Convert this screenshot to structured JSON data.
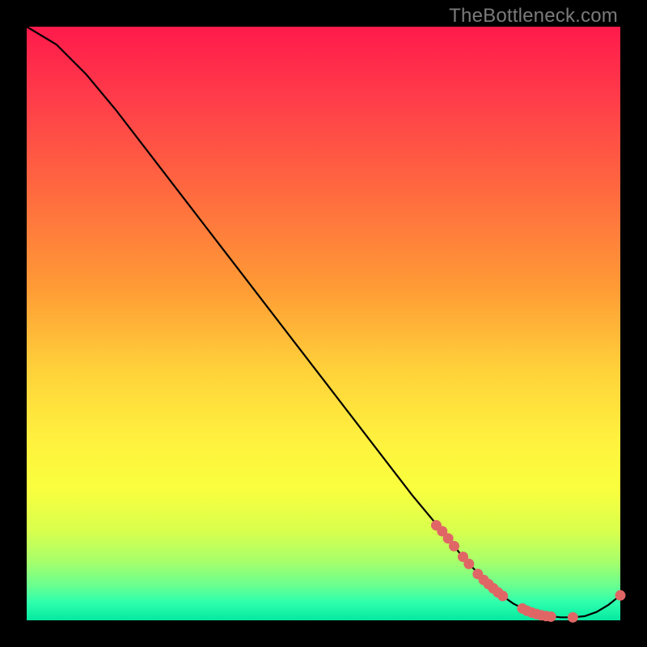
{
  "attribution": "TheBottleneck.com",
  "colors": {
    "background": "#000000",
    "curve": "#000000",
    "marker": "#e06666",
    "gradient_top": "#ff1a4b",
    "gradient_bottom": "#05e8a0"
  },
  "chart_data": {
    "type": "line",
    "title": "",
    "xlabel": "",
    "ylabel": "",
    "xlim": [
      0,
      100
    ],
    "ylim": [
      0,
      100
    ],
    "series": [
      {
        "name": "curve",
        "x": [
          0,
          5,
          10,
          15,
          20,
          25,
          30,
          35,
          40,
          45,
          50,
          55,
          60,
          65,
          70,
          74,
          78,
          80,
          82,
          84,
          86,
          88,
          90,
          92,
          94,
          96,
          98,
          100
        ],
        "y": [
          100,
          97,
          92,
          86,
          79.5,
          73,
          66.5,
          60,
          53.5,
          47,
          40.5,
          34,
          27.5,
          21,
          15,
          10,
          6,
          4.2,
          2.8,
          1.8,
          1.1,
          0.7,
          0.5,
          0.5,
          0.7,
          1.4,
          2.6,
          4.2
        ]
      }
    ],
    "markers": [
      {
        "x": 69,
        "y": 16.0
      },
      {
        "x": 70,
        "y": 15.0
      },
      {
        "x": 71,
        "y": 13.8
      },
      {
        "x": 72,
        "y": 12.5
      },
      {
        "x": 73.5,
        "y": 10.7
      },
      {
        "x": 74.5,
        "y": 9.5
      },
      {
        "x": 76,
        "y": 7.8
      },
      {
        "x": 77,
        "y": 6.8
      },
      {
        "x": 77.8,
        "y": 6.1
      },
      {
        "x": 78.6,
        "y": 5.4
      },
      {
        "x": 79.4,
        "y": 4.7
      },
      {
        "x": 80.2,
        "y": 4.1
      },
      {
        "x": 83.5,
        "y": 2.0
      },
      {
        "x": 84.3,
        "y": 1.6
      },
      {
        "x": 85.1,
        "y": 1.3
      },
      {
        "x": 85.9,
        "y": 1.05
      },
      {
        "x": 86.7,
        "y": 0.85
      },
      {
        "x": 87.5,
        "y": 0.72
      },
      {
        "x": 88.3,
        "y": 0.62
      },
      {
        "x": 92.0,
        "y": 0.5
      },
      {
        "x": 100,
        "y": 4.2
      }
    ]
  }
}
